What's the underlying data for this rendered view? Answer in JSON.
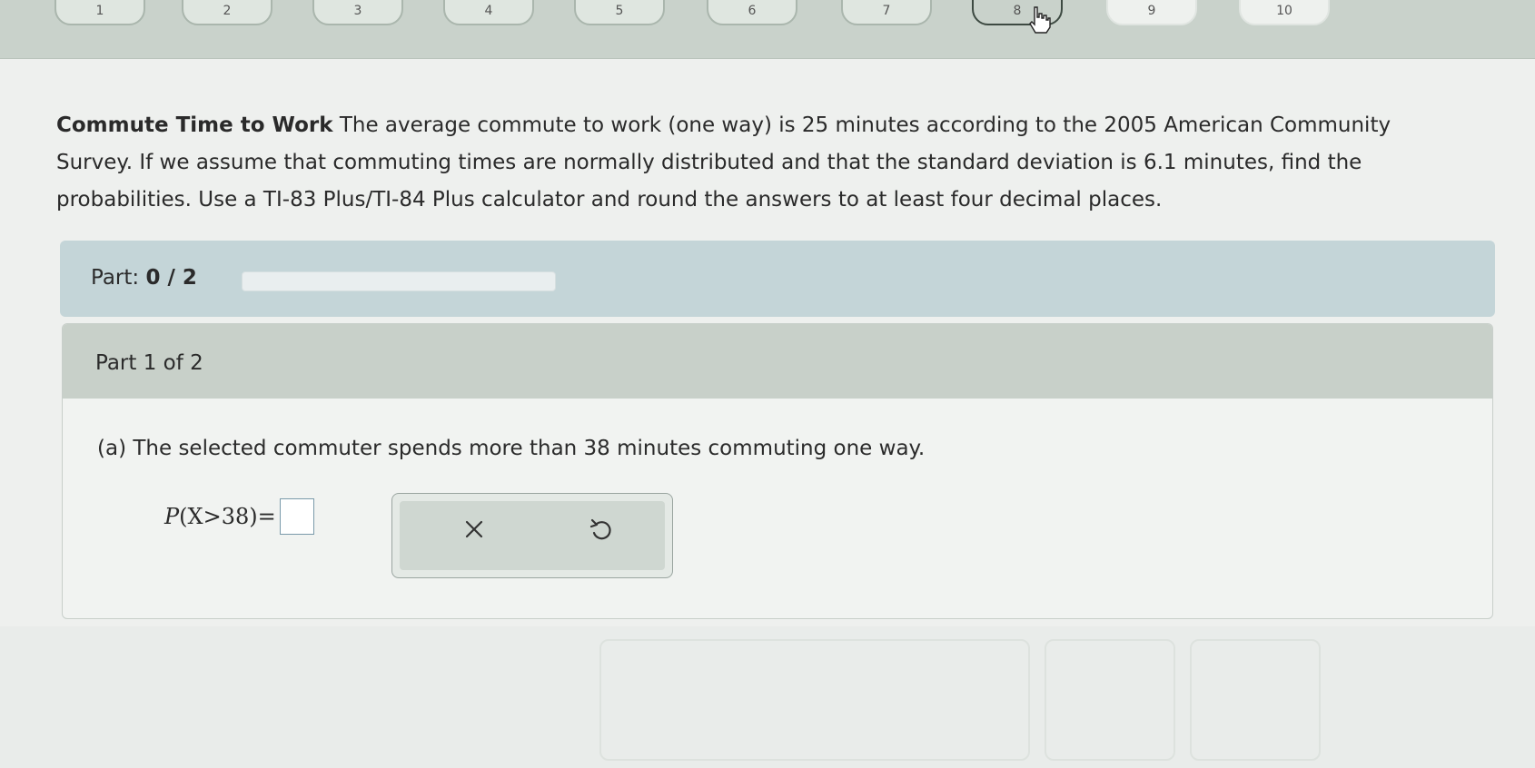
{
  "nav": {
    "question_buttons": [
      "1",
      "2",
      "3",
      "4",
      "5",
      "6",
      "7",
      "8",
      "9",
      "10"
    ],
    "active_index": 7
  },
  "question": {
    "title": "Commute Time to Work",
    "body": "The average commute to work (one way) is 25 minutes according to the 2005 American Community Survey. If we assume that commuting times are normally distributed and that the standard deviation is 6.1 minutes, find the probabilities. Use a TI-83 Plus/TI-84 Plus calculator and round the answers to at least four decimal places."
  },
  "progress": {
    "label": "Part:",
    "count": "0 / 2",
    "fraction": 0
  },
  "part1": {
    "title": "Part 1 of 2",
    "sub_question": "(a) The selected commuter spends more than 38 minutes commuting one way.",
    "math_prefix": "P",
    "math_inner": "(X>38)",
    "math_equals": "=",
    "answer_value": ""
  },
  "actions": {
    "clear_icon": "close-icon",
    "undo_icon": "undo-icon"
  },
  "colors": {
    "progress_panel": "#c4d5d8",
    "part_header": "#c8d0c9",
    "progress_fill": "#3a7d44",
    "answer_border": "#7a9aaa"
  }
}
